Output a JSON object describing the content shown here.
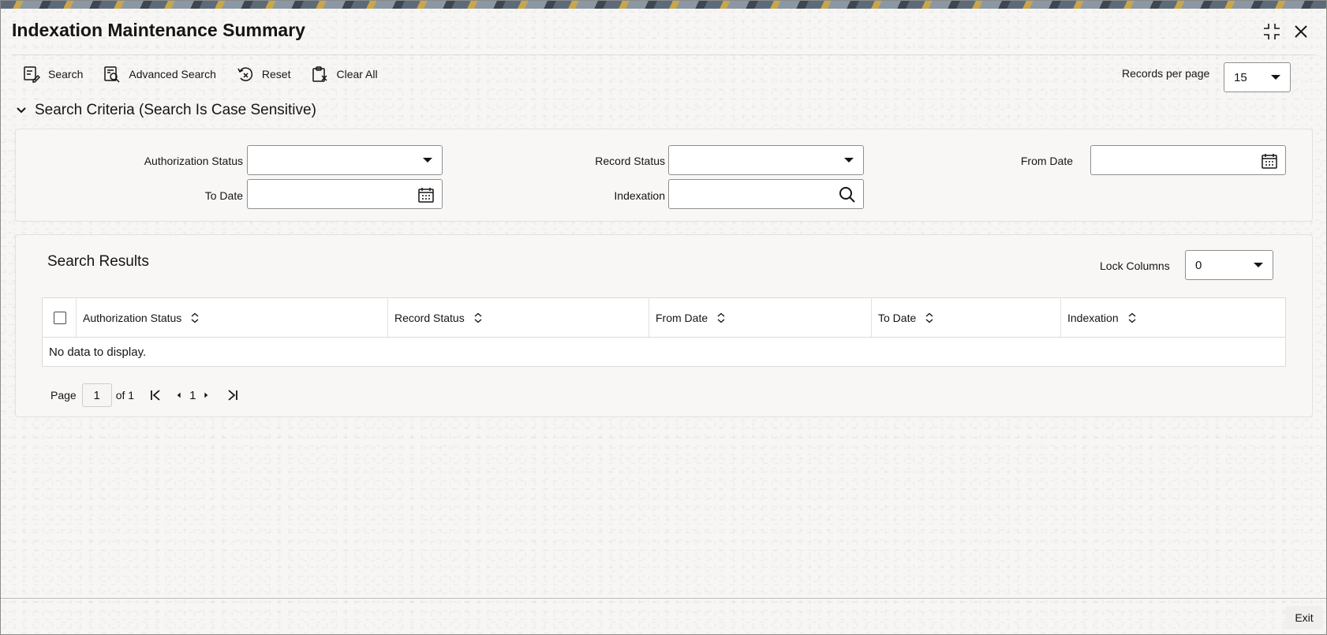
{
  "window": {
    "title": "Indexation Maintenance Summary",
    "exit_label": "Exit"
  },
  "toolbar": {
    "search_label": "Search",
    "advanced_search_label": "Advanced Search",
    "reset_label": "Reset",
    "clear_all_label": "Clear All",
    "records_per_page_label": "Records per page",
    "records_per_page_value": "15"
  },
  "criteria": {
    "header": "Search Criteria (Search Is Case Sensitive)",
    "authorization_status_label": "Authorization Status",
    "authorization_status_value": "",
    "record_status_label": "Record Status",
    "record_status_value": "",
    "from_date_label": "From Date",
    "from_date_value": "",
    "to_date_label": "To Date",
    "to_date_value": "",
    "indexation_label": "Indexation",
    "indexation_value": ""
  },
  "results": {
    "title": "Search Results",
    "lock_columns_label": "Lock Columns",
    "lock_columns_value": "0",
    "columns": [
      "Authorization Status",
      "Record Status",
      "From Date",
      "To Date",
      "Indexation"
    ],
    "empty_message": "No data to display."
  },
  "pager": {
    "page_label": "Page",
    "current_page": "1",
    "of_label": "of 1",
    "page_number": "1"
  },
  "icons": {
    "search": "search-icon",
    "advanced_search": "advanced-search-icon",
    "reset": "reset-icon",
    "clear_all": "clear-all-icon",
    "calendar": "calendar-icon",
    "lookup": "magnifier-icon",
    "maximize": "maximize-icon",
    "close": "close-icon"
  }
}
